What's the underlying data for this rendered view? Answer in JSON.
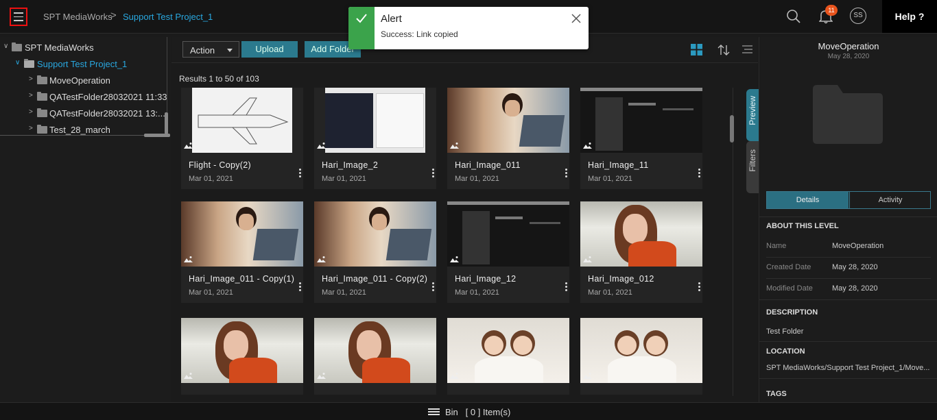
{
  "header": {
    "breadcrumb_root": "SPT MediaWorks",
    "breadcrumb_sep": ">",
    "breadcrumb_current": "Support Test Project_1",
    "notification_count": "11",
    "user_initials": "SS",
    "help_label": "Help ?",
    "icons": [
      "hamburger-menu-icon",
      "search-icon",
      "bell-icon"
    ]
  },
  "alert": {
    "title": "Alert",
    "message": "Success: Link copied",
    "status_color": "#3ba34b"
  },
  "tree": {
    "root": "SPT MediaWorks",
    "project": "Support Test Project_1",
    "children": [
      "MoveOperation",
      "QATestFolder28032021 11:33",
      "QATestFolder28032021 13:...",
      "Test_28_march"
    ]
  },
  "toolbar": {
    "action_label": "Action",
    "upload_label": "Upload",
    "add_folder_label": "Add Folder"
  },
  "results_text": "Results 1 to 50 of 103",
  "grid": {
    "cards": [
      {
        "title": "Flight - Copy(2)",
        "date": "Mar 01, 2021",
        "thumb": "sketch"
      },
      {
        "title": "Hari_Image_2",
        "date": "Mar 01, 2021",
        "thumb": "code"
      },
      {
        "title": "Hari_Image_011",
        "date": "Mar 01, 2021",
        "thumb": "laptop"
      },
      {
        "title": "Hari_Image_11",
        "date": "Mar 01, 2021",
        "thumb": "dark"
      },
      {
        "title": "Hari_Image_011 - Copy(1)",
        "date": "Mar 01, 2021",
        "thumb": "laptop"
      },
      {
        "title": "Hari_Image_011 - Copy(2)",
        "date": "Mar 01, 2021",
        "thumb": "laptop"
      },
      {
        "title": "Hari_Image_12",
        "date": "Mar 01, 2021",
        "thumb": "dark"
      },
      {
        "title": "Hari_Image_012",
        "date": "Mar 01, 2021",
        "thumb": "girl"
      },
      {
        "title": "",
        "date": "",
        "thumb": "girl"
      },
      {
        "title": "",
        "date": "",
        "thumb": "girl"
      },
      {
        "title": "",
        "date": "",
        "thumb": "kids"
      },
      {
        "title": "",
        "date": "",
        "thumb": "kids"
      }
    ]
  },
  "side_tabs": {
    "preview": "Preview",
    "filters": "Filters"
  },
  "details": {
    "name_title": "MoveOperation",
    "name_date": "May 28, 2020",
    "tab_details": "Details",
    "tab_activity": "Activity",
    "about_heading": "ABOUT THIS LEVEL",
    "name_label": "Name",
    "name_value": "MoveOperation",
    "created_label": "Created Date",
    "created_value": "May 28, 2020",
    "modified_label": "Modified Date",
    "modified_value": "May 28, 2020",
    "description_heading": "DESCRIPTION",
    "description_value": "Test Folder",
    "location_heading": "LOCATION",
    "location_value": "SPT MediaWorks/Support Test Project_1/Move...",
    "tags_heading": "TAGS"
  },
  "bin": {
    "label": "Bin",
    "count_text": "[ 0 ] Item(s)"
  },
  "colors": {
    "accent": "#29a8e0",
    "button": "#2b7a8e",
    "badge": "#e8541d"
  }
}
